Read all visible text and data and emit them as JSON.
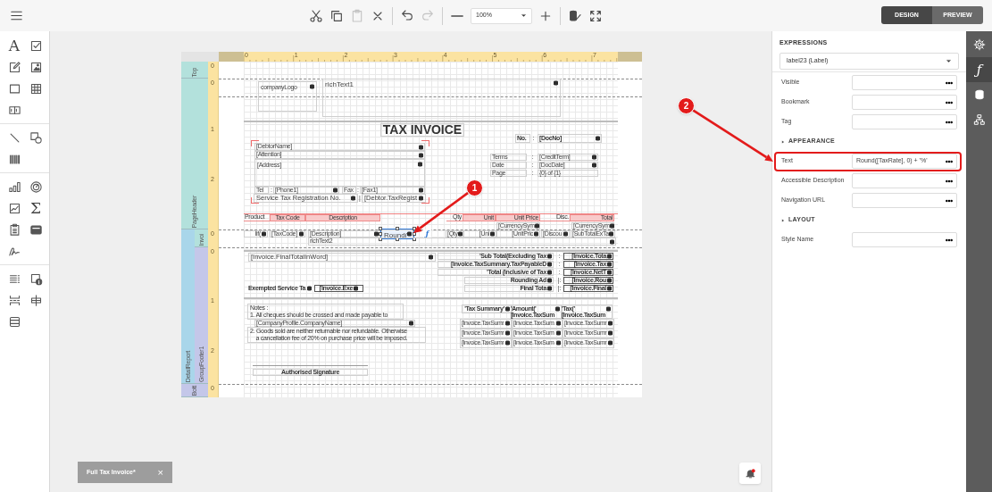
{
  "toolbar": {
    "actions": [
      {
        "kind": "cut",
        "disabled": false
      },
      {
        "kind": "copy",
        "disabled": false
      },
      {
        "kind": "paste",
        "disabled": true
      },
      {
        "kind": "delete",
        "disabled": false
      },
      {
        "kind": "divider"
      },
      {
        "kind": "undo",
        "disabled": false
      },
      {
        "kind": "redo",
        "disabled": true
      },
      {
        "kind": "divider"
      },
      {
        "kind": "zoom_out",
        "disabled": false
      },
      {
        "kind": "zoom",
        "value": "100%"
      },
      {
        "kind": "zoom_in",
        "disabled": false
      },
      {
        "kind": "divider"
      },
      {
        "kind": "validate",
        "disabled": false
      },
      {
        "kind": "fullscreen",
        "disabled": false
      }
    ],
    "modes": [
      {
        "label": "DESIGN",
        "selected": true
      },
      {
        "label": "PREVIEW",
        "selected": false
      }
    ]
  },
  "toolbox": [
    [
      {
        "kind": "glyph",
        "text": "A"
      },
      {
        "kind": "checkbox"
      },
      {
        "kind": "edit"
      },
      {
        "kind": "picture"
      },
      {
        "kind": "panel"
      },
      {
        "kind": "table"
      },
      {
        "kind": "split"
      }
    ],
    [
      {
        "kind": "line"
      },
      {
        "kind": "shapes"
      },
      {
        "kind": "barcode"
      }
    ],
    [
      {
        "kind": "bars"
      },
      {
        "kind": "gauge"
      },
      {
        "kind": "sparkline"
      },
      {
        "kind": "glyph",
        "text": "Σ"
      },
      {
        "kind": "clipboard"
      },
      {
        "kind": "document"
      },
      {
        "kind": "signature"
      }
    ],
    [
      {
        "kind": "list"
      },
      {
        "kind": "info"
      },
      {
        "kind": "pagebreak"
      },
      {
        "kind": "crossband"
      },
      {
        "kind": "band"
      }
    ]
  ],
  "report": {
    "ruler": [
      "0",
      "1",
      "2",
      "3",
      "4",
      "5",
      "6",
      "7"
    ],
    "vertical_ruler": [
      "0",
      "0",
      "1",
      "2",
      "0",
      "0",
      "1",
      "2",
      "0"
    ],
    "bands": [
      {
        "label": "Top"
      },
      {
        "label": "PageHeader"
      },
      {
        "label": "DetailReport"
      },
      {
        "label": "Invoi"
      },
      {
        "label": "GroupFooter1"
      },
      {
        "label": "Bott"
      }
    ],
    "controls": [
      {
        "kind": "frame",
        "text": "companyLogo",
        "bound": true,
        "selected": false
      },
      {
        "kind": "rich",
        "text": "richText1",
        "bound": true,
        "selected": false
      },
      {
        "kind": "title",
        "text": "TAX INVOICE",
        "bound": false,
        "selected": false
      },
      {
        "kind": "boldline",
        "text": "No.",
        "bound": false,
        "selected": false
      },
      {
        "kind": "plain",
        "text": ":",
        "bound": false,
        "selected": false
      },
      {
        "kind": "boldline",
        "text": "[DocNo]",
        "bound": true,
        "selected": false
      },
      {
        "kind": "box",
        "text": "[DebtorName]",
        "bound": true,
        "selected": false
      },
      {
        "kind": "box",
        "text": "[Attention]",
        "bound": true,
        "selected": false
      },
      {
        "kind": "frame",
        "text": "[Address]",
        "bound": true,
        "selected": false
      },
      {
        "kind": "box",
        "text": "Terms",
        "bound": false,
        "selected": false
      },
      {
        "kind": "plain",
        "text": ":",
        "bound": false,
        "selected": false
      },
      {
        "kind": "box",
        "text": "[CreditTerm]",
        "bound": true,
        "selected": false
      },
      {
        "kind": "box",
        "text": "Date",
        "bound": false,
        "selected": false
      },
      {
        "kind": "plain",
        "text": ":",
        "bound": false,
        "selected": false
      },
      {
        "kind": "box",
        "text": "[DocDate]",
        "bound": true,
        "selected": false
      },
      {
        "kind": "box",
        "text": "Page",
        "bound": false,
        "selected": false
      },
      {
        "kind": "plain",
        "text": ":",
        "bound": false,
        "selected": false
      },
      {
        "kind": "box",
        "text": "{0} of {1}",
        "bound": false,
        "selected": false
      },
      {
        "kind": "box",
        "text": "Tel",
        "bound": false,
        "selected": false
      },
      {
        "kind": "plain",
        "text": ":",
        "bound": false,
        "selected": false
      },
      {
        "kind": "box",
        "text": "[Phone1]",
        "bound": true,
        "selected": false
      },
      {
        "kind": "box",
        "text": "Fax",
        "bound": false,
        "selected": false
      },
      {
        "kind": "plain",
        "text": ":",
        "bound": false,
        "selected": false
      },
      {
        "kind": "box",
        "text": "[Fax1]",
        "bound": true,
        "selected": false
      },
      {
        "kind": "large",
        "text": "Service Tax Registration No.",
        "bound": true,
        "selected": false
      },
      {
        "kind": "plain",
        "text": "|",
        "bound": false,
        "selected": false
      },
      {
        "kind": "large",
        "text": "[Debtor.TaxRegist",
        "bound": true,
        "selected": false
      },
      {
        "kind": "head",
        "text": "Product",
        "bound": false,
        "selected": false
      },
      {
        "kind": "headfill",
        "text": "Tax Code",
        "bound": false,
        "selected": false
      },
      {
        "kind": "headfill",
        "text": "Description",
        "bound": false,
        "selected": false
      },
      {
        "kind": "head",
        "text": "Qty",
        "bound": false,
        "selected": false
      },
      {
        "kind": "headfill",
        "text": "Unit",
        "bound": false,
        "selected": false
      },
      {
        "kind": "headfill",
        "text": "Unit Price",
        "bound": false,
        "selected": false
      },
      {
        "kind": "head",
        "text": "Disc.",
        "bound": false,
        "selected": false
      },
      {
        "kind": "headfill",
        "text": "Total",
        "bound": false,
        "selected": false
      },
      {
        "kind": "box",
        "text": "[CurrencySym",
        "bound": true,
        "selected": false
      },
      {
        "kind": "box",
        "text": "[CurrencySym",
        "bound": true,
        "selected": false
      },
      {
        "kind": "box",
        "text": "Iif(",
        "bound": true,
        "selected": false
      },
      {
        "kind": "box",
        "text": "[TaxCode]",
        "bound": true,
        "selected": false
      },
      {
        "kind": "box",
        "text": "[Description]",
        "bound": true,
        "selected": false
      },
      {
        "kind": "rich",
        "text": "Round(",
        "bound": true,
        "selected": true
      },
      {
        "kind": "box",
        "text": "[Qty",
        "bound": true,
        "selected": false
      },
      {
        "kind": "box",
        "text": "[Uni",
        "bound": true,
        "selected": false
      },
      {
        "kind": "box",
        "text": "[UnitPric",
        "bound": true,
        "selected": false
      },
      {
        "kind": "box",
        "text": "[Discou",
        "bound": true,
        "selected": false
      },
      {
        "kind": "box",
        "text": "[SubTotalExTa",
        "bound": true,
        "selected": false
      },
      {
        "kind": "box",
        "text": "richText2",
        "bound": true,
        "selected": false
      },
      {
        "kind": "large",
        "text": "[Invoice.FinalTotalInWord]",
        "bound": true,
        "selected": false
      },
      {
        "kind": "boldline",
        "text": "'Sub Total(Excluding Tax",
        "bound": true,
        "selected": false
      },
      {
        "kind": "plain",
        "text": ":",
        "bound": false,
        "selected": false
      },
      {
        "kind": "boldbox",
        "text": "[Invoice.Tota",
        "bound": true,
        "selected": false
      },
      {
        "kind": "boldline",
        "text": "[Invoice.TaxSummary.TaxPayableD",
        "bound": true,
        "selected": false
      },
      {
        "kind": "plain",
        "text": ":",
        "bound": false,
        "selected": false
      },
      {
        "kind": "boldbox",
        "text": "[Invoice.Tax",
        "bound": true,
        "selected": false
      },
      {
        "kind": "boldline",
        "text": "'Total (Inclusive of Tax",
        "bound": true,
        "selected": false
      },
      {
        "kind": "plain",
        "text": ":",
        "bound": false,
        "selected": false
      },
      {
        "kind": "boldbox",
        "text": "[Invoice.NetT",
        "bound": true,
        "selected": false
      },
      {
        "kind": "boldline",
        "text": "Rounding Ad",
        "bound": true,
        "selected": false
      },
      {
        "kind": "plain",
        "text": "|:",
        "bound": false,
        "selected": false
      },
      {
        "kind": "boldbox",
        "text": "[Invoice.Rou",
        "bound": true,
        "selected": false
      },
      {
        "kind": "bold",
        "text": "Exempted Service Ta",
        "bound": true,
        "selected": false
      },
      {
        "kind": "boldbox",
        "text": "[Invoice.Exe",
        "bound": true,
        "selected": false
      },
      {
        "kind": "boldline",
        "text": "Final Tota",
        "bound": true,
        "selected": false
      },
      {
        "kind": "plain",
        "text": "|:",
        "bound": false,
        "selected": false
      },
      {
        "kind": "boldbox",
        "text": "[Invoice.Final",
        "bound": true,
        "selected": false
      },
      {
        "kind": "note",
        "text": "Notes :\n1. All cheques should be crossed and made payable to",
        "bound": false,
        "selected": false
      },
      {
        "kind": "box",
        "text": "[CompanyProfile.CompanyName]",
        "bound": true,
        "selected": false
      },
      {
        "kind": "note",
        "text": "2. Goods sold are neither returnable nor refundable. Otherwise\n    a cancellation fee of 20% on purchase price will be imposed.",
        "bound": false,
        "selected": false
      },
      {
        "kind": "boldline",
        "text": "'Tax Summary'",
        "bound": true,
        "selected": false
      },
      {
        "kind": "cellbold",
        "text": "'Amount('\n[Invoice.TaxSum",
        "bound": true,
        "selected": false
      },
      {
        "kind": "cellbold",
        "text": "'Tax('\n[Invoice.TaxSum",
        "bound": true,
        "selected": false
      },
      {
        "kind": "cell",
        "text": "[Invoice.TaxSumr",
        "bound": true,
        "selected": false
      },
      {
        "kind": "cell",
        "text": "[Invoice.TaxSum",
        "bound": true,
        "selected": false
      },
      {
        "kind": "cell",
        "text": "[Invoice.TaxSumr",
        "bound": true,
        "selected": false
      },
      {
        "kind": "cell",
        "text": "[Invoice.TaxSumr",
        "bound": true,
        "selected": false
      },
      {
        "kind": "cell",
        "text": "[Invoice.TaxSum",
        "bound": true,
        "selected": false
      },
      {
        "kind": "cell",
        "text": "[Invoice.TaxSumr",
        "bound": true,
        "selected": false
      },
      {
        "kind": "cell",
        "text": "[Invoice.TaxSumr",
        "bound": true,
        "selected": false
      },
      {
        "kind": "cell",
        "text": "[Invoice.TaxSum",
        "bound": true,
        "selected": false
      },
      {
        "kind": "cell",
        "text": "[Invoice.TaxSumr",
        "bound": true,
        "selected": false
      },
      {
        "kind": "boldline",
        "text": "Authorised Signature",
        "bound": false,
        "selected": false
      }
    ],
    "smart_tag": "ƒ"
  },
  "callouts": [
    {
      "number": "1"
    },
    {
      "number": "2"
    }
  ],
  "properties": {
    "section": "EXPRESSIONS",
    "object": "label23 (Label)",
    "rows": [
      {
        "kind": "field",
        "label": "Visible",
        "highlighted": false
      },
      {
        "kind": "field",
        "label": "Bookmark",
        "highlighted": false
      },
      {
        "kind": "field",
        "label": "Tag",
        "highlighted": false
      },
      {
        "kind": "group",
        "label": "APPEARANCE"
      },
      {
        "kind": "field",
        "label": "Text",
        "value": "Round([TaxRate], 0) + '%'",
        "highlighted": true
      },
      {
        "kind": "field",
        "label": "Accessible Description",
        "highlighted": false
      },
      {
        "kind": "field",
        "label": "Navigation URL",
        "highlighted": false
      },
      {
        "kind": "group",
        "label": "LAYOUT"
      },
      {
        "kind": "field",
        "label": "Style Name",
        "highlighted": false
      }
    ]
  },
  "side_tabs": [
    {
      "kind": "settings",
      "selected": false
    },
    {
      "kind": "glyph",
      "text": "ƒ",
      "selected": true
    },
    {
      "kind": "database",
      "selected": false
    },
    {
      "kind": "tree",
      "selected": false
    }
  ],
  "document_tab": {
    "title": "Full Tax Invoice*",
    "close": "×"
  }
}
